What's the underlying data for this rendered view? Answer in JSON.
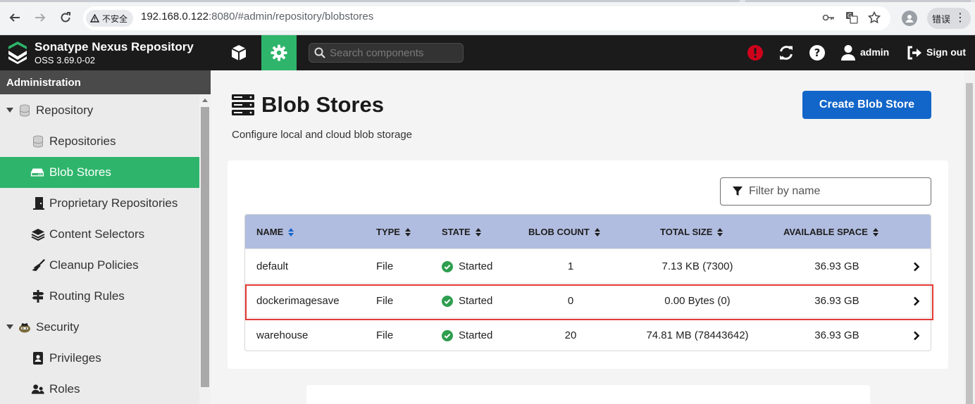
{
  "browser": {
    "security_label": "不安全",
    "url_host": "192.168.0.122",
    "url_rest": ":8080/#admin/repository/blobstores",
    "error_label": "错误"
  },
  "header": {
    "app_name": "Sonatype Nexus Repository",
    "version": "OSS 3.69.0-02",
    "search_placeholder": "Search components",
    "user": "admin",
    "signout": "Sign out",
    "accent": "#2eb56b"
  },
  "sidebar": {
    "title": "Administration",
    "items": [
      {
        "label": "Repository",
        "icon": "database-icon",
        "level": 0,
        "expanded": true
      },
      {
        "label": "Repositories",
        "icon": "database-icon",
        "level": 1
      },
      {
        "label": "Blob Stores",
        "icon": "hard-drive-icon",
        "level": 1,
        "active": true
      },
      {
        "label": "Proprietary Repositories",
        "icon": "door-icon",
        "level": 1
      },
      {
        "label": "Content Selectors",
        "icon": "layers-icon",
        "level": 1
      },
      {
        "label": "Cleanup Policies",
        "icon": "broom-icon",
        "level": 1
      },
      {
        "label": "Routing Rules",
        "icon": "signpost-icon",
        "level": 1
      },
      {
        "label": "Security",
        "icon": "user-secret-icon",
        "level": 0,
        "expanded": true
      },
      {
        "label": "Privileges",
        "icon": "id-badge-icon",
        "level": 1
      },
      {
        "label": "Roles",
        "icon": "users-icon",
        "level": 1
      }
    ]
  },
  "main": {
    "title": "Blob Stores",
    "subtitle": "Configure local and cloud blob storage",
    "create_button": "Create Blob Store",
    "filter_placeholder": "Filter by name",
    "columns": [
      "NAME",
      "TYPE",
      "STATE",
      "BLOB COUNT",
      "TOTAL SIZE",
      "AVAILABLE SPACE"
    ],
    "rows": [
      {
        "name": "default",
        "type": "File",
        "state": "Started",
        "blob_count": "1",
        "total_size": "7.13 KB (7300)",
        "available": "36.93 GB"
      },
      {
        "name": "dockerimagesave",
        "type": "File",
        "state": "Started",
        "blob_count": "0",
        "total_size": "0.00 Bytes (0)",
        "available": "36.93 GB"
      },
      {
        "name": "warehouse",
        "type": "File",
        "state": "Started",
        "blob_count": "20",
        "total_size": "74.81 MB (78443642)",
        "available": "36.93 GB"
      }
    ],
    "status_color": "#2e9e4f",
    "header_color": "#b1bde0",
    "highlight_color": "#e53935"
  }
}
